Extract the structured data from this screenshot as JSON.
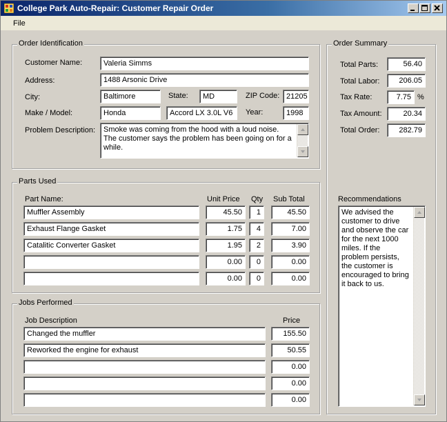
{
  "window": {
    "title": "College Park Auto-Repair: Customer Repair Order"
  },
  "menu": {
    "file": "File"
  },
  "icons": {
    "app": "app-icon",
    "minimize": "minimize-icon",
    "maximize": "maximize-icon",
    "close": "close-icon"
  },
  "order_id": {
    "title": "Order Identification",
    "customer_name_label": "Customer Name:",
    "customer_name": "Valeria Simms",
    "address_label": "Address:",
    "address": "1488 Arsonic Drive",
    "city_label": "City:",
    "city": "Baltimore",
    "state_label": "State:",
    "state": "MD",
    "zip_label": "ZIP Code:",
    "zip": "21205",
    "make_model_label": "Make / Model:",
    "make": "Honda",
    "model": "Accord LX 3.0L V6",
    "year_label": "Year:",
    "year": "1998",
    "problem_label": "Problem Description:",
    "problem": "Smoke was coming from the hood with a loud noise. The customer says the problem has been going on for a while."
  },
  "parts": {
    "title": "Parts Used",
    "headers": {
      "name": "Part Name:",
      "unit_price": "Unit Price",
      "qty": "Qty",
      "subtotal": "Sub Total"
    },
    "rows": [
      {
        "name": "Muffler Assembly",
        "unit_price": "45.50",
        "qty": "1",
        "subtotal": "45.50"
      },
      {
        "name": "Exhaust Flange Gasket",
        "unit_price": "1.75",
        "qty": "4",
        "subtotal": "7.00"
      },
      {
        "name": "Catalitic Converter Gasket",
        "unit_price": "1.95",
        "qty": "2",
        "subtotal": "3.90"
      },
      {
        "name": "",
        "unit_price": "0.00",
        "qty": "0",
        "subtotal": "0.00"
      },
      {
        "name": "",
        "unit_price": "0.00",
        "qty": "0",
        "subtotal": "0.00"
      }
    ]
  },
  "jobs": {
    "title": "Jobs Performed",
    "headers": {
      "description": "Job Description",
      "price": "Price"
    },
    "rows": [
      {
        "description": "Changed the muffler",
        "price": "155.50"
      },
      {
        "description": "Reworked the engine for exhaust",
        "price": "50.55"
      },
      {
        "description": "",
        "price": "0.00"
      },
      {
        "description": "",
        "price": "0.00"
      },
      {
        "description": "",
        "price": "0.00"
      }
    ]
  },
  "summary": {
    "title": "Order Summary",
    "total_parts_label": "Total Parts:",
    "total_parts": "56.40",
    "total_labor_label": "Total Labor:",
    "total_labor": "206.05",
    "tax_rate_label": "Tax Rate:",
    "tax_rate": "7.75",
    "tax_rate_unit": "%",
    "tax_amount_label": "Tax Amount:",
    "tax_amount": "20.34",
    "total_order_label": "Total Order:",
    "total_order": "282.79",
    "recommendations_label": "Recommendations",
    "recommendations": "We advised the customer to drive and observe the car for the next 1000 miles. If the problem persists, the customer is encouraged to bring it back to us."
  }
}
